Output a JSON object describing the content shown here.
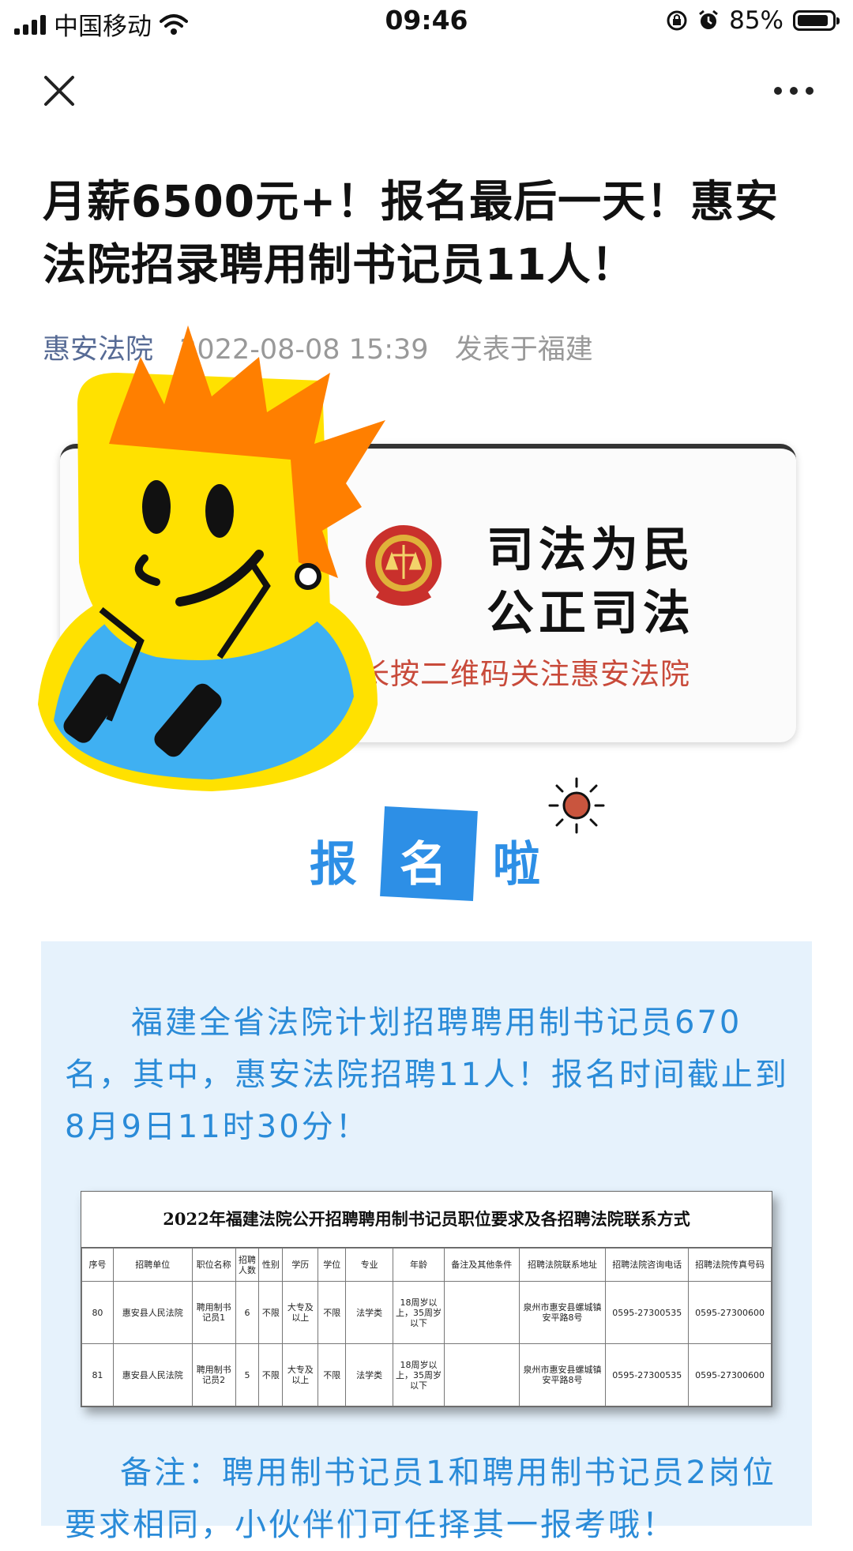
{
  "status_bar": {
    "carrier": "中国移动",
    "time": "09:46",
    "battery": "85%"
  },
  "article": {
    "title": "月薪6500元+！报名最后一天！惠安法院招录聘用制书记员11人！",
    "author": "惠安法院",
    "date": "2022-08-08 15:39",
    "location": "发表于福建"
  },
  "banner": {
    "line1": "司法为民",
    "line2": "公正司法",
    "qr_text": "长按二维码关注惠安法院"
  },
  "signup": {
    "c1": "报",
    "c2": "名",
    "c3": "啦"
  },
  "intro": "福建全省法院计划招聘聘用制书记员670名，其中，惠安法院招聘11人！报名时间截止到8月9日11时30分！",
  "table": {
    "title": "2022年福建法院公开招聘聘用制书记员职位要求及各招聘法院联系方式",
    "headers": [
      "序号",
      "招聘单位",
      "职位名称",
      "招聘人数",
      "性别",
      "学历",
      "学位",
      "专业",
      "年龄",
      "备注及其他条件",
      "招聘法院联系地址",
      "招聘法院咨询电话",
      "招聘法院传真号码"
    ],
    "rows": [
      [
        "80",
        "惠安县人民法院",
        "聘用制书记员1",
        "6",
        "不限",
        "大专及以上",
        "不限",
        "法学类",
        "18周岁以上，35周岁以下",
        "",
        "泉州市惠安县螺城镇安平路8号",
        "0595-27300535",
        "0595-27300600"
      ],
      [
        "81",
        "惠安县人民法院",
        "聘用制书记员2",
        "5",
        "不限",
        "大专及以上",
        "不限",
        "法学类",
        "18周岁以上，35周岁以下",
        "",
        "泉州市惠安县螺城镇安平路8号",
        "0595-27300535",
        "0595-27300600"
      ]
    ]
  },
  "note": "备注：聘用制书记员1和聘用制书记员2岗位要求相同，小伙伴们可任择其一报考哦！",
  "colors": {
    "accent_blue": "#2d8fe6",
    "author_link": "#576b95",
    "content_bg": "#e6f2fc"
  },
  "icons": {
    "close": "close-icon",
    "more": "more-icon"
  }
}
